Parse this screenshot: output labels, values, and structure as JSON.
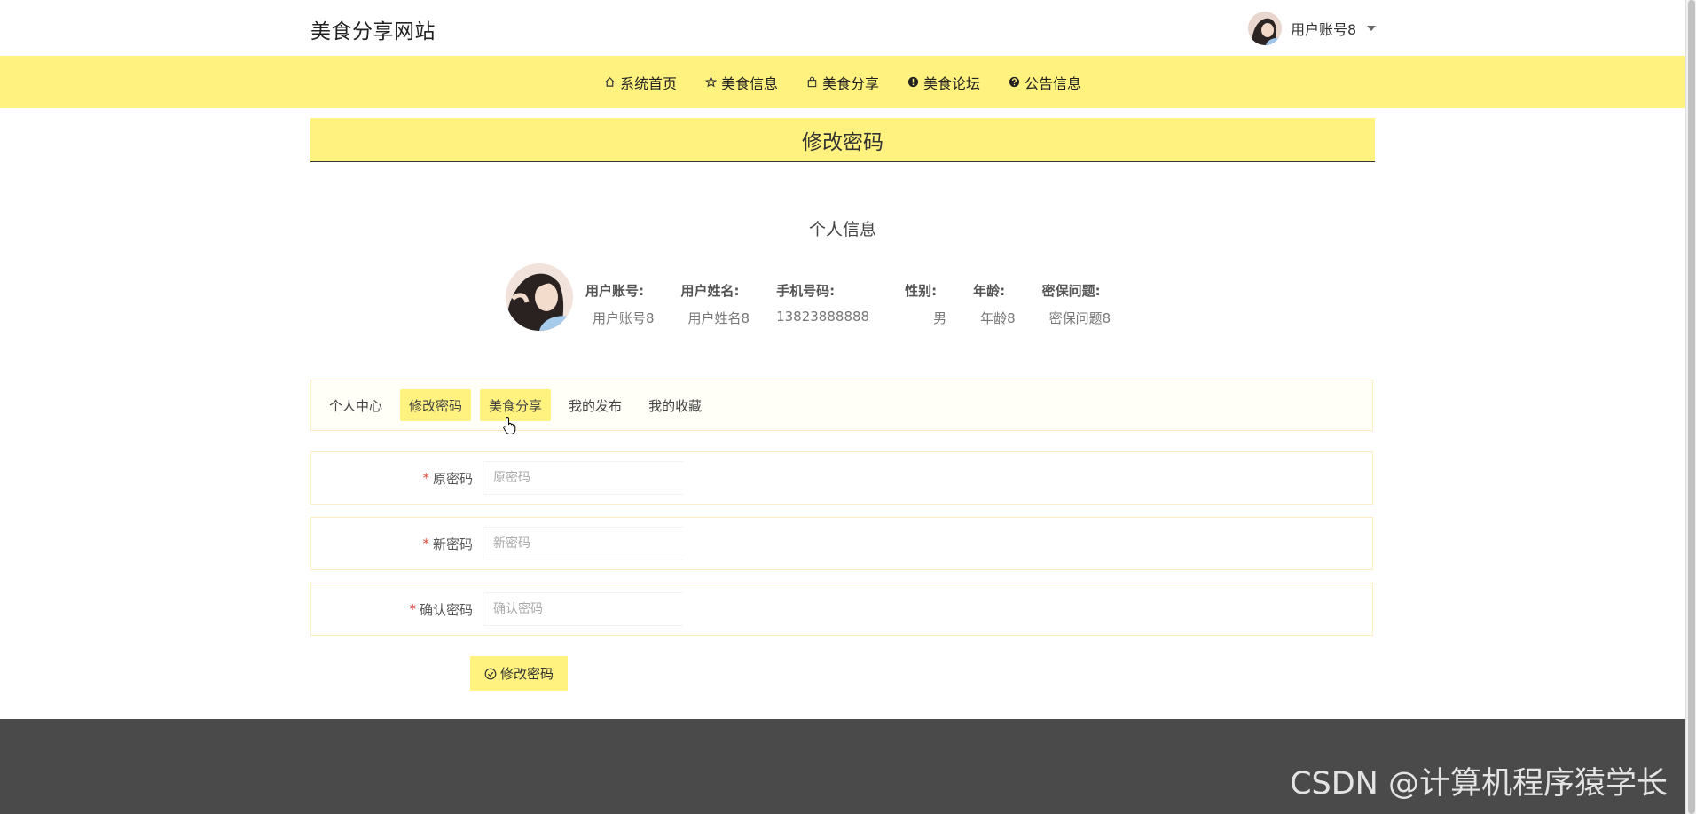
{
  "header": {
    "brand": "美食分享网站",
    "user_name": "用户账号8"
  },
  "nav": {
    "items": [
      {
        "label": "系统首页",
        "icon": "home-icon"
      },
      {
        "label": "美食信息",
        "icon": "star-icon"
      },
      {
        "label": "美食分享",
        "icon": "bag-icon"
      },
      {
        "label": "美食论坛",
        "icon": "exclamation-circle-icon"
      },
      {
        "label": "公告信息",
        "icon": "question-circle-icon"
      }
    ]
  },
  "page_title": "修改密码",
  "profile": {
    "section_title": "个人信息",
    "fields": [
      {
        "label": "用户账号:",
        "value": "用户账号8"
      },
      {
        "label": "用户姓名:",
        "value": "用户姓名8"
      },
      {
        "label": "手机号码:",
        "value": "13823888888"
      },
      {
        "label": "性别:",
        "value": "男"
      },
      {
        "label": "年龄:",
        "value": "年龄8"
      },
      {
        "label": "密保问题:",
        "value": "密保问题8"
      }
    ]
  },
  "tabs": [
    {
      "label": "个人中心",
      "state": "normal"
    },
    {
      "label": "修改密码",
      "state": "active"
    },
    {
      "label": "美食分享",
      "state": "hover"
    },
    {
      "label": "我的发布",
      "state": "normal"
    },
    {
      "label": "我的收藏",
      "state": "normal"
    }
  ],
  "form": {
    "required_mark": "*",
    "old_password": {
      "label": "原密码",
      "placeholder": "原密码",
      "value": ""
    },
    "new_password": {
      "label": "新密码",
      "placeholder": "新密码",
      "value": ""
    },
    "confirm_password": {
      "label": "确认密码",
      "placeholder": "确认密码",
      "value": ""
    },
    "submit_label": "修改密码"
  },
  "watermark": "CSDN @计算机程序猿学长",
  "colors": {
    "accent_yellow": "#fff27f",
    "footer_bg": "#4a4a4a",
    "required_red": "#e74c3c"
  }
}
